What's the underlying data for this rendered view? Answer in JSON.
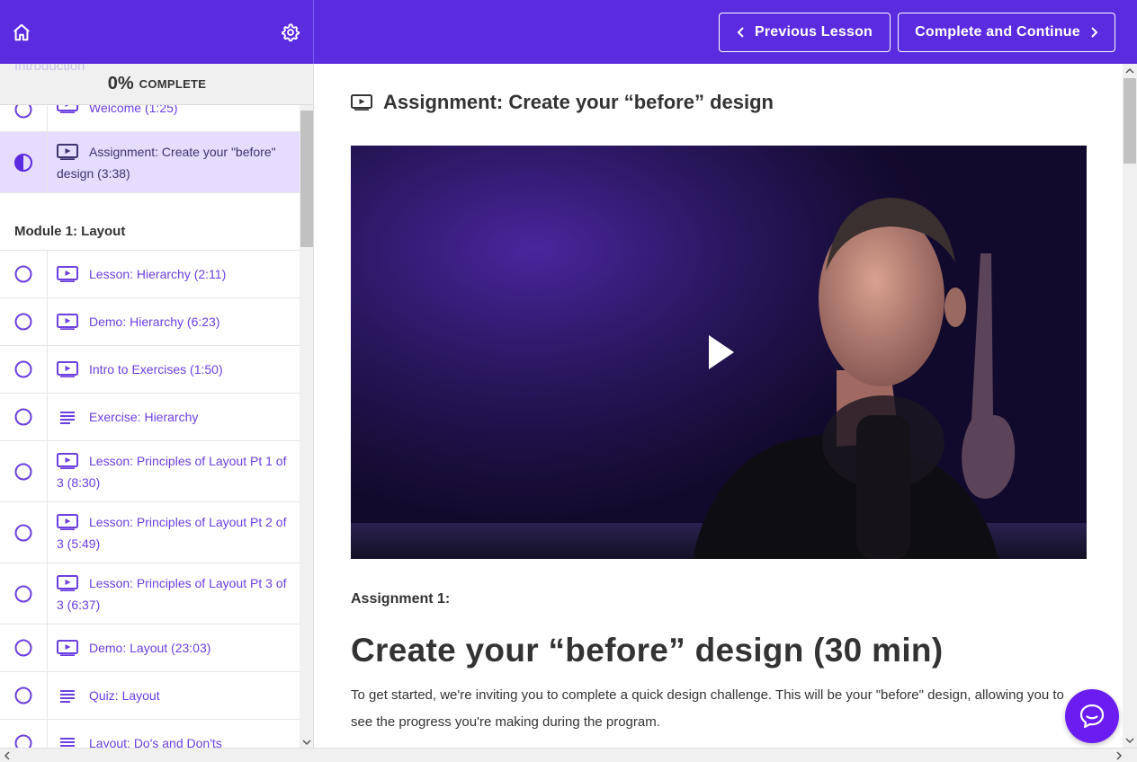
{
  "header": {
    "previous_label": "Previous Lesson",
    "next_label": "Complete and Continue",
    "brand_color": "#5b2be0"
  },
  "sidebar": {
    "progress_ghost": "Introduction",
    "progress_percent": "0%",
    "progress_word": "COMPLETE",
    "intro_items": [
      {
        "label": "Welcome (1:25)",
        "icon": "video-icon",
        "status": "not-started"
      },
      {
        "label": "Assignment: Create your \"before\" design (3:38)",
        "icon": "video-icon",
        "status": "in-progress",
        "active": true
      }
    ],
    "module_title": "Module 1: Layout",
    "module_items": [
      {
        "label": "Lesson: Hierarchy (2:11)",
        "icon": "video-icon"
      },
      {
        "label": "Demo: Hierarchy (6:23)",
        "icon": "video-icon"
      },
      {
        "label": "Intro to Exercises (1:50)",
        "icon": "video-icon"
      },
      {
        "label": "Exercise: Hierarchy",
        "icon": "text-icon"
      },
      {
        "label": "Lesson: Principles of Layout Pt 1 of 3 (8:30)",
        "icon": "video-icon"
      },
      {
        "label": "Lesson: Principles of Layout Pt 2 of 3 (5:49)",
        "icon": "video-icon"
      },
      {
        "label": "Lesson: Principles of Layout Pt 3 of 3 (6:37)",
        "icon": "video-icon"
      },
      {
        "label": "Demo: Layout (23:03)",
        "icon": "video-icon"
      },
      {
        "label": "Quiz: Layout",
        "icon": "text-icon"
      },
      {
        "label": "Layout: Do's and Don'ts",
        "icon": "text-icon"
      }
    ]
  },
  "main": {
    "lesson_title": "Assignment: Create your “before” design",
    "section_label": "Assignment 1:",
    "heading": "Create your “before” design (30 min)",
    "body": "To get started, we're inviting you to complete a quick design challenge. This will be your \"before\" design, allowing you to see the progress you're making during the program."
  }
}
